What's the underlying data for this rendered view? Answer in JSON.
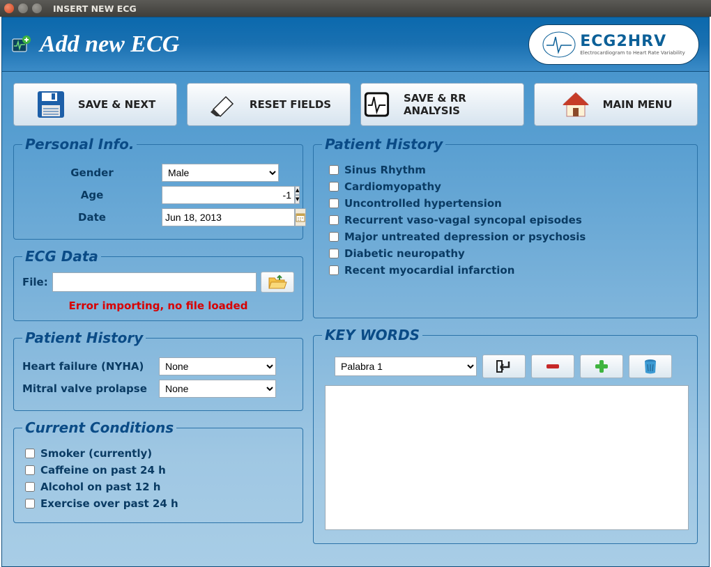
{
  "window": {
    "title": "INSERT NEW ECG"
  },
  "header": {
    "title": "Add new ECG",
    "logo_main": "ECG2HRV",
    "logo_sub": "Electrocardiogram to Heart Rate Variability"
  },
  "toolbar": {
    "save_next": "SAVE & NEXT",
    "reset_fields": "RESET FIELDS",
    "save_rr": "SAVE & RR ANALYSIS",
    "main_menu": "MAIN MENU"
  },
  "personal_info": {
    "legend": "Personal Info.",
    "gender_label": "Gender",
    "gender_value": "Male",
    "age_label": "Age",
    "age_value": "-1",
    "date_label": "Date",
    "date_value": "Jun 18, 2013"
  },
  "ecg_data": {
    "legend": "ECG Data",
    "file_label": "File:",
    "file_value": "",
    "error_msg": "Error importing, no file loaded"
  },
  "patient_history_left": {
    "legend": "Patient History",
    "heart_failure_label": "Heart failure (NYHA)",
    "heart_failure_value": "None",
    "mitral_label": "Mitral valve prolapse",
    "mitral_value": "None"
  },
  "current_conditions": {
    "legend": "Current Conditions",
    "items": [
      "Smoker (currently)",
      "Caffeine on past 24 h",
      "Alcohol on past 12 h",
      "Exercise over past 24 h"
    ]
  },
  "patient_history_right": {
    "legend": "Patient History",
    "items": [
      "Sinus Rhythm",
      "Cardiomyopathy",
      "Uncontrolled hypertension",
      "Recurrent vaso-vagal syncopal episodes",
      "Major untreated depression or psychosis",
      "Diabetic neuropathy",
      "Recent myocardial infarction"
    ]
  },
  "keywords": {
    "legend": "KEY WORDS",
    "combo_value": "Palabra 1",
    "area_value": ""
  }
}
